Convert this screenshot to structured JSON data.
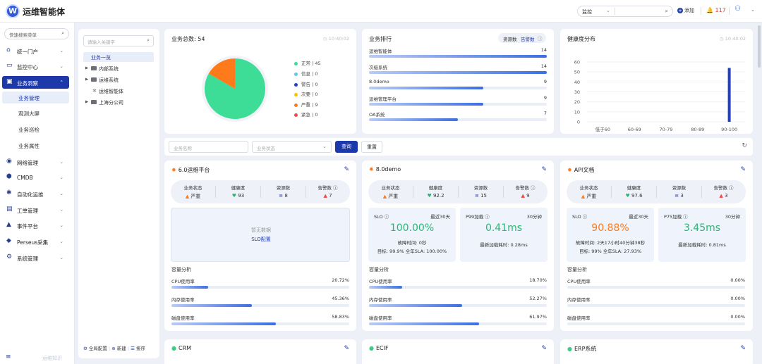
{
  "app": {
    "title": "运维智能体",
    "logo_letter": "W"
  },
  "topbar": {
    "select_value": "监控",
    "add_label": "添加",
    "alarm_count": "117"
  },
  "sidebar": {
    "search_placeholder": "快速搜索菜单",
    "items": [
      {
        "label": "统一门户",
        "icon": "portal-icon"
      },
      {
        "label": "监控中心",
        "icon": "monitor-icon"
      },
      {
        "label": "业务洞察",
        "icon": "insight-icon",
        "active": true
      },
      {
        "label": "网络管理",
        "icon": "network-icon"
      },
      {
        "label": "CMDB",
        "icon": "cmdb-icon"
      },
      {
        "label": "自动化运维",
        "icon": "automation-icon"
      },
      {
        "label": "工单管理",
        "icon": "ticket-icon"
      },
      {
        "label": "事件平台",
        "icon": "event-icon"
      },
      {
        "label": "Perseus采集",
        "icon": "collect-icon"
      },
      {
        "label": "系统管理",
        "icon": "settings-icon"
      }
    ],
    "sub_items": [
      "业务管理",
      "观测大屏",
      "业务巡检",
      "业务属性"
    ],
    "footer_text": "运维知识"
  },
  "tree": {
    "search_placeholder": "请输入关键字",
    "root": "业务一览",
    "nodes": [
      {
        "label": "内部系统",
        "type": "folder"
      },
      {
        "label": "运维系统",
        "type": "folder"
      },
      {
        "label": "运维智能体",
        "type": "leaf"
      },
      {
        "label": "上海分公司",
        "type": "folder"
      }
    ],
    "footer": {
      "config": "全局配置",
      "new": "新建",
      "sort": "排序"
    }
  },
  "total_card": {
    "title": "业务总数: 54",
    "time": "10:40:02",
    "legend": [
      {
        "label": "正常",
        "value": "45",
        "color": "#3ddc97"
      },
      {
        "label": "信息",
        "value": "0",
        "color": "#5cc8f0"
      },
      {
        "label": "警告",
        "value": "0",
        "color": "#2240c8"
      },
      {
        "label": "次要",
        "value": "0",
        "color": "#f5c400"
      },
      {
        "label": "严重",
        "value": "9",
        "color": "#ff7a1a"
      },
      {
        "label": "紧急",
        "value": "0",
        "color": "#f04848"
      }
    ],
    "pie": [
      {
        "label": "正常",
        "value": 45,
        "color": "#3ddc97"
      },
      {
        "label": "严重",
        "value": 9,
        "color": "#ff7a1a"
      }
    ]
  },
  "rank_card": {
    "title": "业务排行",
    "toggle": [
      "资源数",
      "告警数"
    ],
    "max": 14,
    "rows": [
      {
        "name": "运维智能体",
        "value": "14"
      },
      {
        "name": "次级系统",
        "value": "14"
      },
      {
        "name": "8.0demo",
        "value": "9"
      },
      {
        "name": "运维管理平台",
        "value": "9"
      },
      {
        "name": "OA系统",
        "value": "7"
      }
    ]
  },
  "health_card": {
    "title": "健康度分布",
    "time": "10:40:02"
  },
  "chart_data": {
    "type": "bar",
    "categories": [
      "低于60",
      "60-69",
      "70-79",
      "80-89",
      "90-100"
    ],
    "values": [
      0,
      0,
      0,
      0,
      54
    ],
    "yticks": [
      "0",
      "10",
      "20",
      "30",
      "40",
      "50",
      "60"
    ],
    "ylim": [
      0,
      60
    ]
  },
  "filter": {
    "name_placeholder": "业务名称",
    "status_placeholder": "业务状态",
    "query": "查询",
    "reset": "重置"
  },
  "cards": [
    {
      "title": "6.0运维平台",
      "labels": [
        "业务状态",
        "健康度",
        "资源数",
        "告警数"
      ],
      "status": "严重",
      "health": "93",
      "resources": "8",
      "alarms": "7",
      "slo_empty": true,
      "empty_text": "暂无数据",
      "empty_link": "SLO配置",
      "capacity_title": "容量分析",
      "capacity": [
        {
          "name": "CPU使用率",
          "value": "20.72%",
          "pct": 20.72
        },
        {
          "name": "内存使用率",
          "value": "45.36%",
          "pct": 45.36
        },
        {
          "name": "磁盘使用率",
          "value": "58.83%",
          "pct": 58.83
        }
      ]
    },
    {
      "title": "8.0demo",
      "labels": [
        "业务状态",
        "健康度",
        "资源数",
        "告警数"
      ],
      "status": "严重",
      "health": "92.2",
      "resources": "15",
      "alarms": "9",
      "slo_empty": false,
      "slo": {
        "label": "SLO",
        "period": "最近30天",
        "value": "100.00%",
        "value_color": "#2bb673",
        "line1": "故障时间: 0秒",
        "line2": "目标: 99.9%  全年SLA: 100.00%"
      },
      "p": {
        "label": "P99加载",
        "period": "30分钟",
        "value": "0.41ms",
        "line1": "最新加载耗时: 0.28ms"
      },
      "capacity_title": "容量分析",
      "capacity": [
        {
          "name": "CPU使用率",
          "value": "18.70%",
          "pct": 18.7
        },
        {
          "name": "内存使用率",
          "value": "52.27%",
          "pct": 52.27
        },
        {
          "name": "磁盘使用率",
          "value": "61.97%",
          "pct": 61.97
        }
      ]
    },
    {
      "title": "API文档",
      "labels": [
        "业务状态",
        "健康度",
        "资源数",
        "告警数"
      ],
      "status": "严重",
      "health": "97.6",
      "resources": "3",
      "alarms": "3",
      "slo_empty": false,
      "slo": {
        "label": "SLO",
        "period": "最近30天",
        "value": "90.88%",
        "value_color": "#ff7a1a",
        "line1": "故障时间: 2天17小时40分钟38秒",
        "line2": "目标: 99%  全年SLA: 27.93%"
      },
      "p": {
        "label": "P75加载",
        "period": "30分钟",
        "value": "3.45ms",
        "line1": "最新加载耗时: 0.81ms"
      },
      "capacity_title": "容量分析",
      "capacity": [
        {
          "name": "CPU使用率",
          "value": "0.00%",
          "pct": 0
        },
        {
          "name": "内存使用率",
          "value": "0.00%",
          "pct": 0
        },
        {
          "name": "磁盘使用率",
          "value": "0.00%",
          "pct": 0
        }
      ]
    }
  ],
  "bottom_cards": [
    "CRM",
    "ECIF",
    "ERP系统"
  ]
}
